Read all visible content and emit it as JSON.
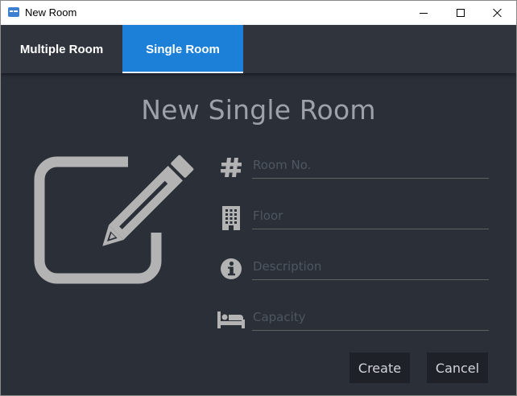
{
  "window": {
    "title": "New Room",
    "icon": "app-window-icon",
    "controls": [
      "minimize-icon",
      "maximize-icon",
      "close-icon"
    ]
  },
  "tabs": [
    {
      "label": "Multiple Room",
      "selected": false
    },
    {
      "label": "Single Room",
      "selected": true
    }
  ],
  "form": {
    "title": "New Single Room",
    "illustration": "edit-icon",
    "fields": [
      {
        "icon": "hash-icon",
        "placeholder": "Room No.",
        "value": ""
      },
      {
        "icon": "building-icon",
        "placeholder": "Floor",
        "value": ""
      },
      {
        "icon": "info-icon",
        "placeholder": "Description",
        "value": ""
      },
      {
        "icon": "bed-icon",
        "placeholder": "Capacity",
        "value": ""
      }
    ],
    "create_label": "Create",
    "cancel_label": "Cancel"
  },
  "colors": {
    "background": "#2a2f38",
    "tab_bar": "#2f343d",
    "accent": "#1c7fd8",
    "icon_gray": "#b3b3b3",
    "button_bg": "#1e2127"
  }
}
